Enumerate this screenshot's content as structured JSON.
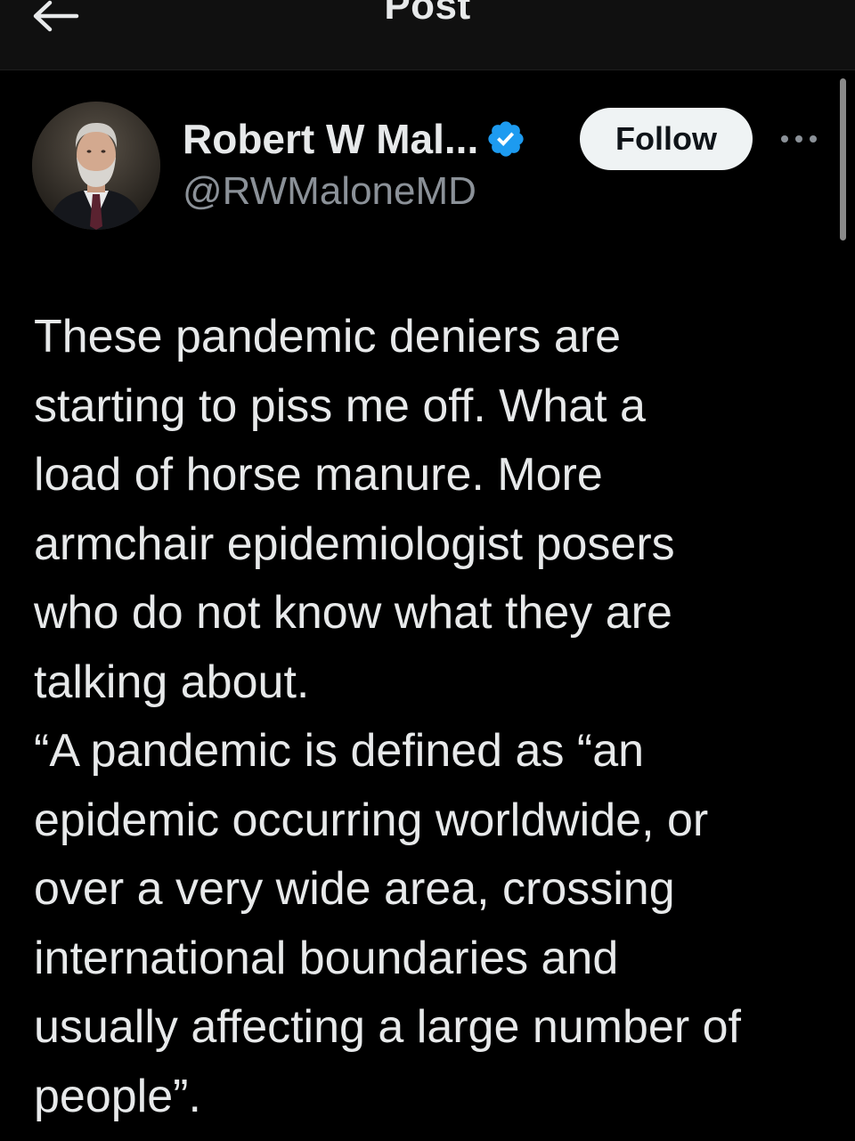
{
  "header": {
    "title": "Post",
    "back_icon": "arrow-left-icon"
  },
  "author": {
    "name": "Robert W Mal...",
    "handle": "@RWMaloneMD",
    "verified_icon": "verified-badge-icon",
    "verified_color": "#1d9bf0",
    "avatar_icon": "avatar"
  },
  "actions": {
    "follow_label": "Follow",
    "more_icon": "more-options-icon"
  },
  "post": {
    "lines": [
      "These pandemic deniers are",
      "starting to piss me off.  What a",
      "load of horse manure.  More",
      "armchair epidemiologist posers",
      "who do not know what they are",
      "talking about.",
      "“A pandemic is defined as “an",
      "epidemic occurring worldwide, or",
      "over a very wide area, crossing",
      "international boundaries and",
      "usually affecting a large number of",
      "people”."
    ]
  },
  "colors": {
    "background": "#000000",
    "header_background": "#101010",
    "text_primary": "#e7e9ea",
    "text_secondary": "#8b9198",
    "follow_bg": "#eff3f4"
  }
}
